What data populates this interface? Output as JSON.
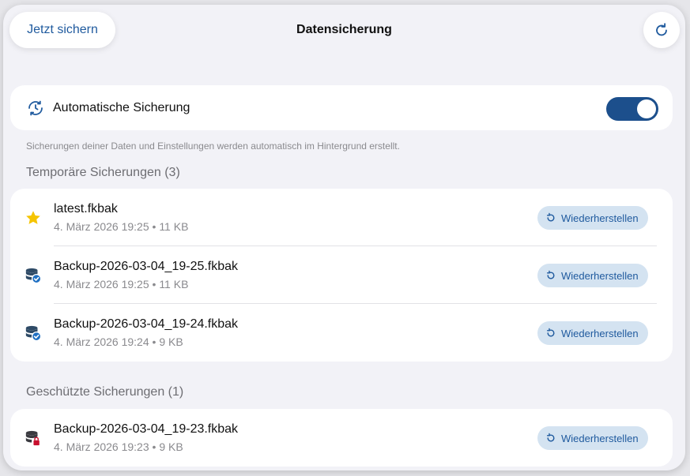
{
  "nav": {
    "backup_now_label": "Jetzt sichern",
    "title": "Datensicherung"
  },
  "auto_backup": {
    "label": "Automatische Sicherung",
    "enabled": true,
    "footer": "Sicherungen deiner Daten und Einstellungen werden automatisch im Hintergrund erstellt."
  },
  "temporary": {
    "title": "Temporäre Sicherungen (3)",
    "items": [
      {
        "icon": "star-icon",
        "name": "latest.fkbak",
        "meta": "4. März 2026 19:25 • 11 KB",
        "restore_label": "Wiederherstellen"
      },
      {
        "icon": "database-check-icon",
        "name": "Backup-2026-03-04_19-25.fkbak",
        "meta": "4. März 2026 19:25 • 11 KB",
        "restore_label": "Wiederherstellen"
      },
      {
        "icon": "database-check-icon",
        "name": "Backup-2026-03-04_19-24.fkbak",
        "meta": "4. März 2026 19:24 • 9 KB",
        "restore_label": "Wiederherstellen"
      }
    ]
  },
  "protected": {
    "title": "Geschützte Sicherungen (1)",
    "items": [
      {
        "icon": "database-lock-icon",
        "name": "Backup-2026-03-04_19-23.fkbak",
        "meta": "4. März 2026 19:23 • 9 KB",
        "restore_label": "Wiederherstellen"
      }
    ]
  },
  "colors": {
    "accent": "#1f5a9e",
    "toggle_on": "#1c4f8c",
    "restore_bg": "#d4e3f1",
    "star": "#f5c400",
    "lock": "#c8102e"
  }
}
